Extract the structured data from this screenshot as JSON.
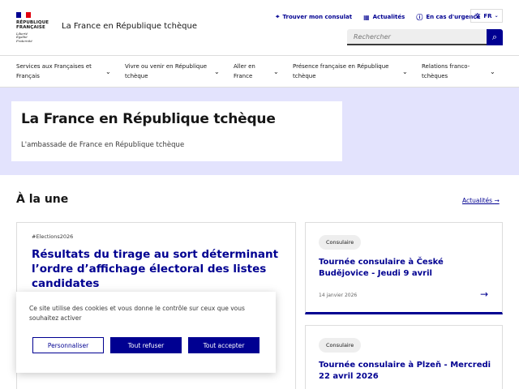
{
  "header": {
    "logo_lines": [
      "RÉPUBLIQUE",
      "FRANÇAISE"
    ],
    "motto_lines": [
      "Liberté",
      "Égalité",
      "Fraternité"
    ],
    "site_title": "La France en République tchèque",
    "tools": {
      "consulat": "Trouver mon consulat",
      "actualites": "Actualités",
      "urgence": "En cas d'urgence"
    },
    "lang": "FR",
    "search_placeholder": "Rechercher"
  },
  "nav": {
    "items": [
      "Services aux Françaises et Français",
      "Vivre ou venir en République tchèque",
      "Aller en France",
      "Présence française en République tchèque",
      "Relations franco-tchèques"
    ]
  },
  "hero": {
    "title": "La France en République tchèque",
    "subtitle": "L'ambassade de France en République tchèque"
  },
  "news": {
    "section_title": "À la une",
    "section_link": "Actualités",
    "main": {
      "tag": "#Elections2026",
      "title": "Résultats du tirage au sort déterminant l’ordre d’affichage électoral des listes candidates"
    },
    "cards": [
      {
        "badge": "Consulaire",
        "title": "Tournée consulaire à České Budějovice - Jeudi 9 avril",
        "date": "14 janvier 2026"
      },
      {
        "badge": "Consulaire",
        "title": "Tournée consulaire à Plzeň - Mercredi 22 avril 2026"
      }
    ]
  },
  "cookie": {
    "text": "Ce site utilise des cookies et vous donne le contrôle sur ceux que vous souhaitez activer",
    "personalize": "Personnaliser",
    "refuse_all": "Tout refuser",
    "accept_all": "Tout accepter"
  },
  "colors": {
    "primary": "#000091",
    "hero_bg": "#e3e3fd",
    "flag_blue": "#000091",
    "flag_red": "#e1000f"
  },
  "icons": {
    "consulat": "location-pin-icon",
    "actualites": "calendar-icon",
    "urgence": "info-circle-icon",
    "lang": "translate-icon",
    "search": "search-icon",
    "chevron": "chevron-down-icon",
    "arrow": "arrow-right-icon"
  }
}
